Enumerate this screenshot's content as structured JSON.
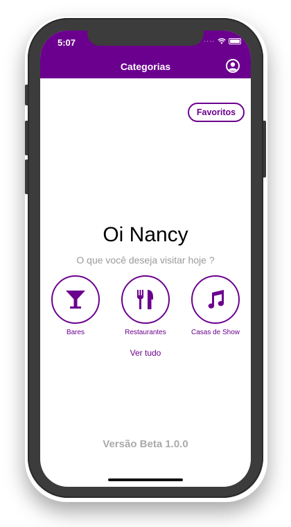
{
  "status_bar": {
    "time": "5:07"
  },
  "header": {
    "title": "Categorias",
    "background_color": "#6b008e",
    "profile_icon": "user-circle-icon"
  },
  "favorites_button": {
    "label": "Favoritos"
  },
  "greeting": "Oi Nancy",
  "subtitle": "O que você deseja visitar hoje ?",
  "categories": [
    {
      "label": "Bares",
      "icon": "cocktail-glass-icon"
    },
    {
      "label": "Restaurantes",
      "icon": "fork-knife-icon"
    },
    {
      "label": "Casas de Show",
      "icon": "music-note-icon"
    }
  ],
  "see_all": "Ver tudo",
  "version": "Versão Beta 1.0.0",
  "accent_color": "#6b008e"
}
